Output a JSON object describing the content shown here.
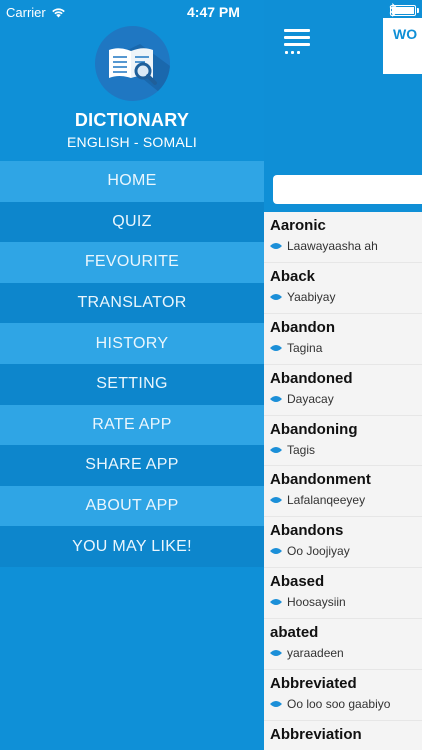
{
  "status_bar": {
    "carrier": "Carrier",
    "time": "4:47 PM"
  },
  "drawer": {
    "app_title": "DICTIONARY",
    "app_subtitle": "ENGLISH - SOMALI",
    "menu": [
      {
        "label": "HOME"
      },
      {
        "label": "QUIZ"
      },
      {
        "label": "FEVOURITE"
      },
      {
        "label": "TRANSLATOR"
      },
      {
        "label": "HISTORY"
      },
      {
        "label": "SETTING"
      },
      {
        "label": "RATE APP"
      },
      {
        "label": "SHARE APP"
      },
      {
        "label": "ABOUT APP"
      },
      {
        "label": "YOU MAY LIKE!"
      }
    ]
  },
  "content": {
    "card_text": "WO",
    "words": [
      {
        "en": "Aaronic",
        "so": "Laawayaasha ah"
      },
      {
        "en": "Aback",
        "so": "Yaabiyay"
      },
      {
        "en": "Abandon",
        "so": "Tagina"
      },
      {
        "en": "Abandoned",
        "so": "Dayacay"
      },
      {
        "en": "Abandoning",
        "so": "Tagis"
      },
      {
        "en": "Abandonment",
        "so": "Lafalanqeeyey"
      },
      {
        "en": "Abandons",
        "so": "Oo Joojiyay"
      },
      {
        "en": "Abased",
        "so": "Hoosaysiin"
      },
      {
        "en": "abated",
        "so": "yaraadeen"
      },
      {
        "en": "Abbreviated",
        "so": "Oo loo soo gaabiyo"
      },
      {
        "en": "Abbreviation",
        "so": ""
      }
    ]
  },
  "colors": {
    "primary": "#0f8fd6",
    "menu_light": "#2fa5e5",
    "menu_dark": "#0d86cc"
  }
}
